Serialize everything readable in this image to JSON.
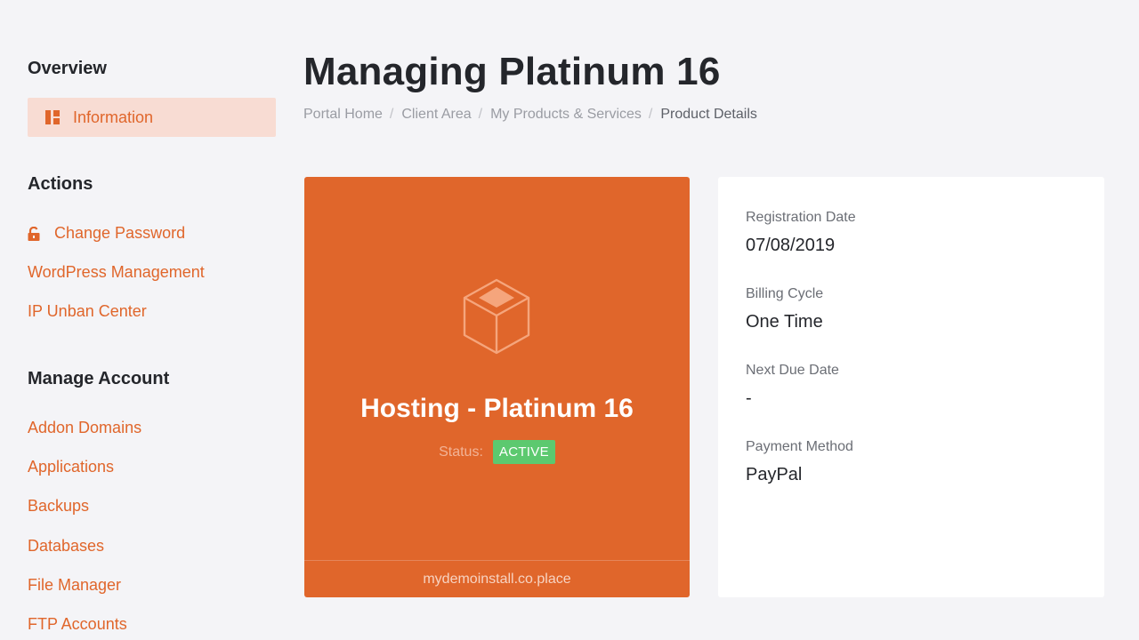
{
  "page": {
    "title": "Managing Platinum 16",
    "accent_color": "#e0662b",
    "background_color": "#f4f4f7"
  },
  "breadcrumb": {
    "items": [
      "Portal Home",
      "Client Area",
      "My Products & Services"
    ],
    "current": "Product Details",
    "separator": "/"
  },
  "sidebar": {
    "overview": {
      "title": "Overview",
      "active_item": {
        "label": "Information",
        "icon": "dashboard-icon"
      }
    },
    "actions": {
      "title": "Actions",
      "items": [
        {
          "label": "Change Password",
          "icon": "lock-icon"
        },
        {
          "label": "WordPress Management"
        },
        {
          "label": "IP Unban Center"
        }
      ]
    },
    "manage_account": {
      "title": "Manage Account",
      "items": [
        {
          "label": "Addon Domains"
        },
        {
          "label": "Applications"
        },
        {
          "label": "Backups"
        },
        {
          "label": "Databases"
        },
        {
          "label": "File Manager"
        },
        {
          "label": "FTP Accounts"
        }
      ]
    }
  },
  "product": {
    "icon": "box-icon",
    "name": "Hosting - Platinum 16",
    "status_label": "Status:",
    "status": "ACTIVE",
    "status_color": "#5cc96f",
    "domain": "mydemoinstall.co.place"
  },
  "details": {
    "registration_date_label": "Registration Date",
    "registration_date": "07/08/2019",
    "billing_cycle_label": "Billing Cycle",
    "billing_cycle": "One Time",
    "next_due_date_label": "Next Due Date",
    "next_due_date": "-",
    "payment_method_label": "Payment Method",
    "payment_method": "PayPal"
  }
}
